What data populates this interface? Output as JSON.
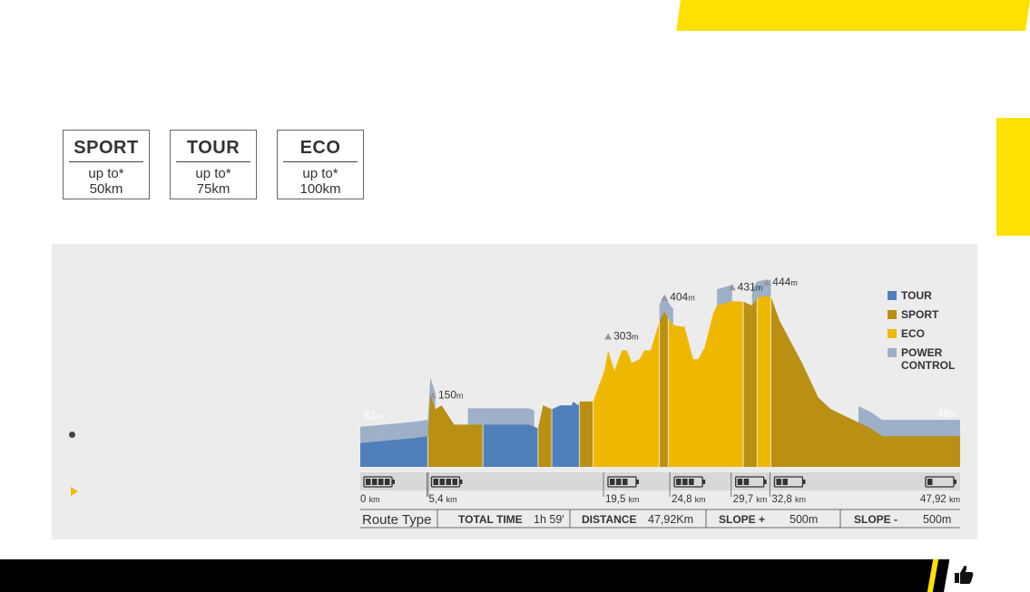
{
  "modes": [
    {
      "name": "SPORT",
      "line1": "up to*",
      "line2": "50km"
    },
    {
      "name": "TOUR",
      "line1": "up to*",
      "line2": "75km"
    },
    {
      "name": "ECO",
      "line1": "up to*",
      "line2": "100km"
    }
  ],
  "colors": {
    "tour": "#4f7fba",
    "sport": "#b98f14",
    "eco": "#efb800",
    "power_control": "#9db0c8",
    "accent_yellow": "#ffe000"
  },
  "chart_data": {
    "type": "area",
    "title": "",
    "xlabel": "",
    "ylabel": "",
    "x_unit": "km",
    "y_unit": "m",
    "xlim": [
      0,
      47.92
    ],
    "ylim": [
      0,
      460
    ],
    "legend": [
      "TOUR",
      "SPORT",
      "ECO",
      "POWER CONTROL"
    ],
    "legend_position": "right",
    "series": [
      {
        "name": "TOUR",
        "segments": [
          [
            0,
            5.4
          ],
          [
            9.8,
            14.2
          ],
          [
            15.3,
            17.5
          ]
        ]
      },
      {
        "name": "SPORT",
        "segments": [
          [
            5.4,
            9.8
          ],
          [
            14.2,
            15.3
          ],
          [
            17.5,
            18.6
          ],
          [
            23.9,
            24.6
          ],
          [
            30.6,
            31.7
          ],
          [
            32.8,
            47.92
          ]
        ]
      },
      {
        "name": "ECO",
        "segments": [
          [
            18.6,
            23.9
          ],
          [
            24.6,
            30.6
          ],
          [
            31.7,
            32.8
          ]
        ]
      }
    ],
    "elevation_profile": {
      "x": [
        0,
        4.3,
        5.4,
        5.6,
        6.0,
        6.5,
        6.7,
        7.5,
        9.8,
        13.5,
        14.2,
        14.6,
        15.3,
        16.0,
        16.9,
        17.0,
        17.4,
        17.5,
        18.6,
        19.5,
        19.8,
        20.3,
        20.9,
        21.3,
        21.7,
        22.3,
        22.7,
        23.2,
        23.9,
        24.3,
        24.8,
        25.0,
        25.6,
        25.9,
        26.6,
        27.0,
        27.5,
        28.2,
        28.5,
        29.7,
        30.6,
        31.3,
        31.7,
        32.3,
        32.8,
        33.5,
        35.3,
        36.6,
        37.6,
        40.8,
        41.7,
        47.92
      ],
      "y": [
        62,
        75,
        80,
        190,
        150,
        160,
        150,
        110,
        110,
        110,
        100,
        160,
        150,
        160,
        160,
        170,
        160,
        170,
        170,
        250,
        303,
        250,
        303,
        303,
        270,
        280,
        303,
        303,
        380,
        404,
        376,
        370,
        365,
        365,
        280,
        280,
        310,
        400,
        420,
        431,
        430,
        420,
        440,
        444,
        444,
        380,
        270,
        180,
        150,
        100,
        80,
        80
      ]
    },
    "power_control": {
      "name": "POWER CONTROL",
      "segments": [
        [
          0,
          5.4
        ],
        [
          5.4,
          6.0
        ],
        [
          8.6,
          13.9
        ],
        [
          23.9,
          25.0
        ],
        [
          28.5,
          29.7
        ],
        [
          31.3,
          32.8
        ],
        [
          39.8,
          47.92
        ]
      ]
    },
    "peaks": [
      {
        "label": "150",
        "unit": "m",
        "x": 5.8,
        "y": 150
      },
      {
        "label": "303",
        "unit": "m",
        "x": 19.8,
        "y": 303
      },
      {
        "label": "404",
        "unit": "m",
        "x": 24.3,
        "y": 404
      },
      {
        "label": "431",
        "unit": "m",
        "x": 29.7,
        "y": 431
      },
      {
        "label": "444",
        "unit": "m",
        "x": 32.5,
        "y": 444
      }
    ],
    "endpoints": [
      {
        "label": "62",
        "unit": "m",
        "position": "start"
      },
      {
        "label": "48",
        "unit": "m",
        "position": "end"
      }
    ],
    "km_markers": [
      {
        "label": "0",
        "unit": "km",
        "value": 0,
        "battery_level": 4
      },
      {
        "label": "5,4",
        "unit": "km",
        "value": 5.4,
        "battery_level": 4
      },
      {
        "label": "19,5",
        "unit": "km",
        "value": 19.5,
        "battery_level": 3
      },
      {
        "label": "24,8",
        "unit": "km",
        "value": 24.8,
        "battery_level": 3
      },
      {
        "label": "29,7",
        "unit": "km",
        "value": 29.7,
        "battery_level": 2
      },
      {
        "label": "32,8",
        "unit": "km",
        "value": 32.8,
        "battery_level": 2
      },
      {
        "label": "47,92",
        "unit": "km",
        "value": 47.92,
        "battery_level": 1
      }
    ],
    "route_table": {
      "title": "Route Type",
      "cells": [
        {
          "label": "TOTAL TIME",
          "value": "1h 59'"
        },
        {
          "label": "DISTANCE",
          "value": "47,92Km"
        },
        {
          "label": "SLOPE +",
          "value": "500m"
        },
        {
          "label": "SLOPE -",
          "value": "500m"
        }
      ]
    }
  }
}
